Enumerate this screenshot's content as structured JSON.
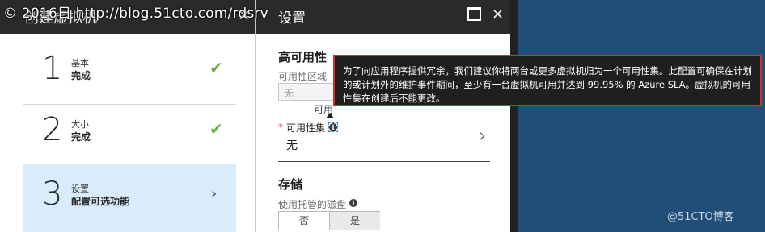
{
  "left_blade": {
    "title": "创建虚拟机",
    "close": "×",
    "steps": [
      {
        "num": "1",
        "name": "基本",
        "sub": "完成",
        "state": "done"
      },
      {
        "num": "2",
        "name": "大小",
        "sub": "完成",
        "state": "done"
      },
      {
        "num": "3",
        "name": "设置",
        "sub": "配置可选功能",
        "state": "active"
      }
    ],
    "check_glyph": "✔",
    "chevron_glyph": "›"
  },
  "right_blade": {
    "title": "设置",
    "maximize_icon": "maximize-icon",
    "close": "×",
    "sections": {
      "ha": {
        "heading": "高可用性",
        "zone_label": "可用性区域",
        "zone_value": "无",
        "zone_hint": "可用",
        "set_label": "可用性集",
        "set_required": "*",
        "set_value": "无",
        "set_chevron": "›"
      },
      "storage": {
        "heading": "存储",
        "managed_disk_label": "使用托管的磁盘",
        "toggle_no": "否",
        "toggle_yes": "是"
      }
    },
    "info_glyph": "i"
  },
  "tooltip": {
    "text": "为了向应用程序提供冗余，我们建议你将两台或更多虚拟机归为一个可用性集。此配置可确保在计划的或计划外的维护事件期间，至少有一台虚拟机可用并达到 99.95% 的 Azure SLA。虚拟机的可用性集在创建后不能更改。"
  },
  "watermarks": {
    "top": "© 2016日 http://blog.51cto.com/rdsrv",
    "bottom": "@51CTO博客"
  },
  "colors": {
    "header": "#2a2a2a",
    "active_step": "#d9ecfb",
    "check": "#6ab04c",
    "tooltip_border": "#d32f2f",
    "azure_blue": "#1f4e79"
  }
}
